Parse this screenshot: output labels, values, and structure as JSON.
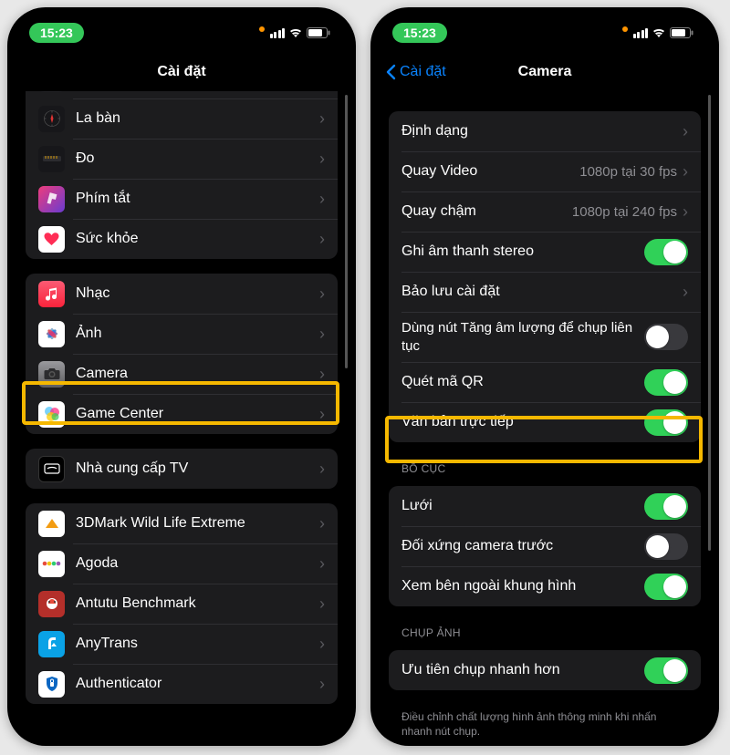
{
  "status": {
    "time": "15:23"
  },
  "left": {
    "title": "Cài đặt",
    "group1": [
      {
        "label": "La bàn",
        "iconBg": "#1c1c1e"
      },
      {
        "label": "Đo",
        "iconBg": "#1c1c1e"
      },
      {
        "label": "Phím tắt",
        "iconBg": "linear-gradient(135deg,#ff2d82,#5856d6)"
      },
      {
        "label": "Sức khỏe",
        "iconBg": "#fff"
      }
    ],
    "group2": [
      {
        "label": "Nhạc",
        "iconBg": "linear-gradient(180deg,#fb5b74,#fa233b)"
      },
      {
        "label": "Ảnh",
        "iconBg": "#fff"
      },
      {
        "label": "Camera",
        "iconBg": "linear-gradient(180deg,#9a9a9d,#77777a)"
      },
      {
        "label": "Game Center",
        "iconBg": "#fff"
      }
    ],
    "group3": [
      {
        "label": "Nhà cung cấp TV",
        "iconBg": "#000"
      }
    ],
    "group4": [
      {
        "label": "3DMark Wild Life Extreme",
        "iconBg": "#fff"
      },
      {
        "label": "Agoda",
        "iconBg": "#fff"
      },
      {
        "label": "Antutu Benchmark",
        "iconBg": "#c0392b"
      },
      {
        "label": "AnyTrans",
        "iconBg": "#0aa2e6"
      },
      {
        "label": "Authenticator",
        "iconBg": "#fff"
      }
    ]
  },
  "right": {
    "back": "Cài đặt",
    "title": "Camera",
    "group1": [
      {
        "label": "Định dạng",
        "type": "disclosure"
      },
      {
        "label": "Quay Video",
        "value": "1080p tại 30 fps",
        "type": "disclosure"
      },
      {
        "label": "Quay chậm",
        "value": "1080p tại 240 fps",
        "type": "disclosure"
      },
      {
        "label": "Ghi âm thanh stereo",
        "type": "switch",
        "on": true
      },
      {
        "label": "Bảo lưu cài đặt",
        "type": "disclosure"
      },
      {
        "label": "Dùng nút Tăng âm lượng để chụp liên tục",
        "type": "switch",
        "on": false,
        "twoline": true
      },
      {
        "label": "Quét mã QR",
        "type": "switch",
        "on": true
      },
      {
        "label": "Văn bản trực tiếp",
        "type": "switch",
        "on": true
      }
    ],
    "sec2_header": "BỐ CỤC",
    "group2": [
      {
        "label": "Lưới",
        "type": "switch",
        "on": true
      },
      {
        "label": "Đối xứng camera trước",
        "type": "switch",
        "on": false
      },
      {
        "label": "Xem bên ngoài khung hình",
        "type": "switch",
        "on": true
      }
    ],
    "sec3_header": "CHỤP ẢNH",
    "group3": [
      {
        "label": "Ưu tiên chụp nhanh hơn",
        "type": "switch",
        "on": true
      }
    ],
    "footer": "Điều chỉnh chất lượng hình ảnh thông minh khi nhấn nhanh nút chụp."
  }
}
